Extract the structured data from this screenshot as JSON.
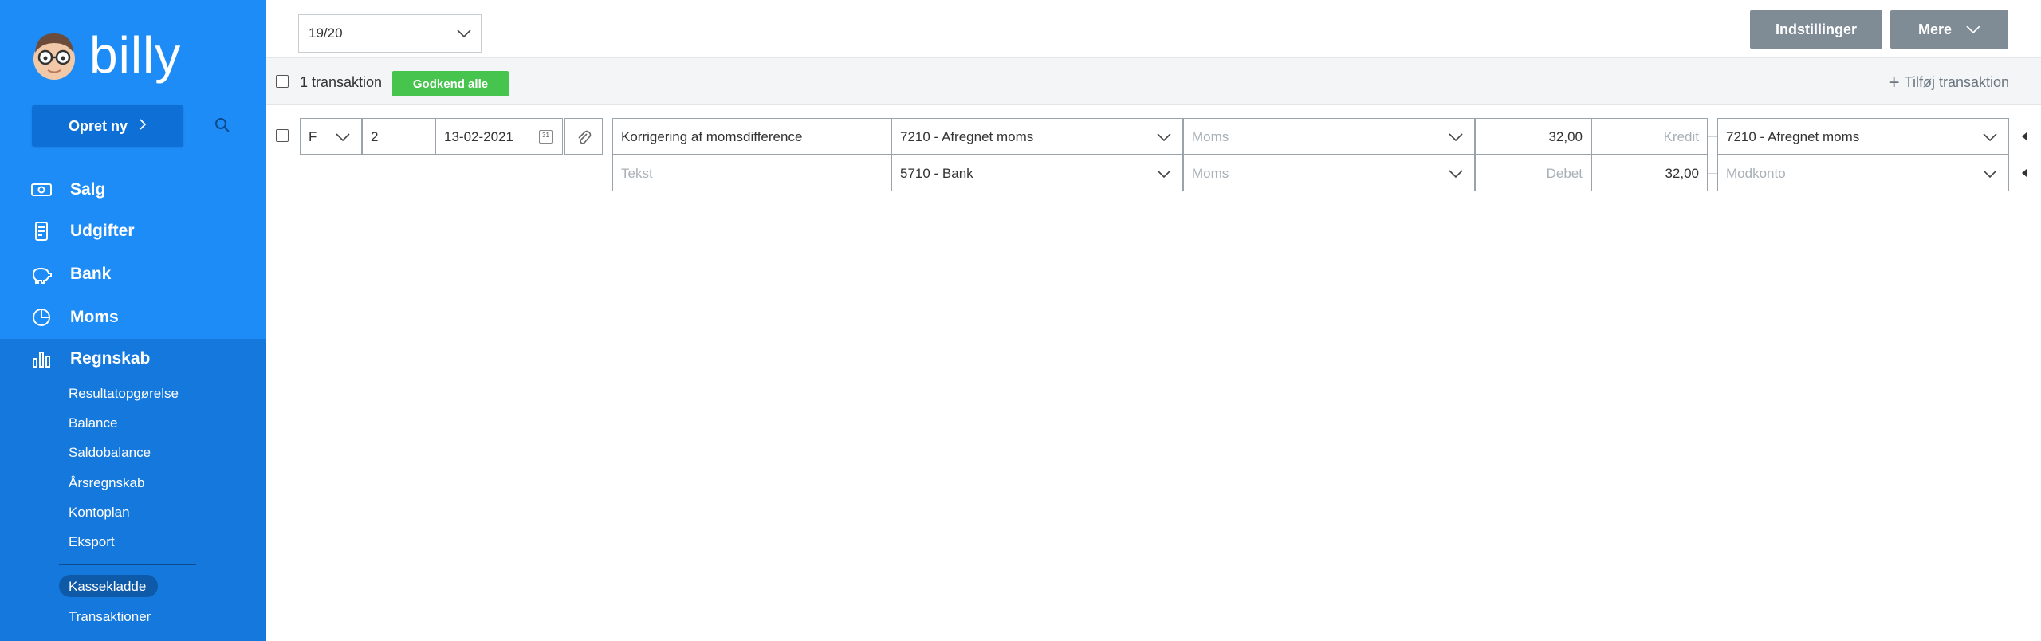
{
  "sidebar": {
    "brand": "billy",
    "create_label": "Opret ny",
    "nav": [
      {
        "label": "Salg",
        "icon": "money-icon"
      },
      {
        "label": "Udgifter",
        "icon": "receipt-icon"
      },
      {
        "label": "Bank",
        "icon": "piggy-bank-icon"
      },
      {
        "label": "Moms",
        "icon": "pie-chart-icon"
      },
      {
        "label": "Regnskab",
        "icon": "bar-chart-icon"
      }
    ],
    "sub_items": [
      {
        "label": "Resultatopgørelse"
      },
      {
        "label": "Balance"
      },
      {
        "label": "Saldobalance"
      },
      {
        "label": "Årsregnskab"
      },
      {
        "label": "Kontoplan"
      },
      {
        "label": "Eksport"
      },
      {
        "label": "Kassekladde"
      },
      {
        "label": "Transaktioner"
      }
    ]
  },
  "topbar": {
    "period": "19/20",
    "settings_label": "Indstillinger",
    "more_label": "Mere"
  },
  "toolbar": {
    "count_text": "1 transaktion",
    "approve_label": "Godkend alle",
    "add_label": "Tilføj transaktion"
  },
  "transaction": {
    "type": "F",
    "number": "2",
    "date": "13-02-2021",
    "calendar_glyph": "31",
    "line1": {
      "text": "Korrigering af momsdifference",
      "account": "7210 - Afregnet moms",
      "vat_placeholder": "Moms",
      "debit": "32,00",
      "credit_placeholder": "Kredit",
      "counter_account": "7210 - Afregnet moms"
    },
    "line2": {
      "text_placeholder": "Tekst",
      "account": "5710 - Bank",
      "vat_placeholder": "Moms",
      "debit_placeholder": "Debet",
      "credit": "32,00",
      "counter_placeholder": "Modkonto"
    }
  },
  "colors": {
    "sidebar_bg": "#1e8cf7",
    "sidebar_section_bg": "#1478dc",
    "approve_green": "#46c44e",
    "button_grey": "#7f8b95"
  }
}
